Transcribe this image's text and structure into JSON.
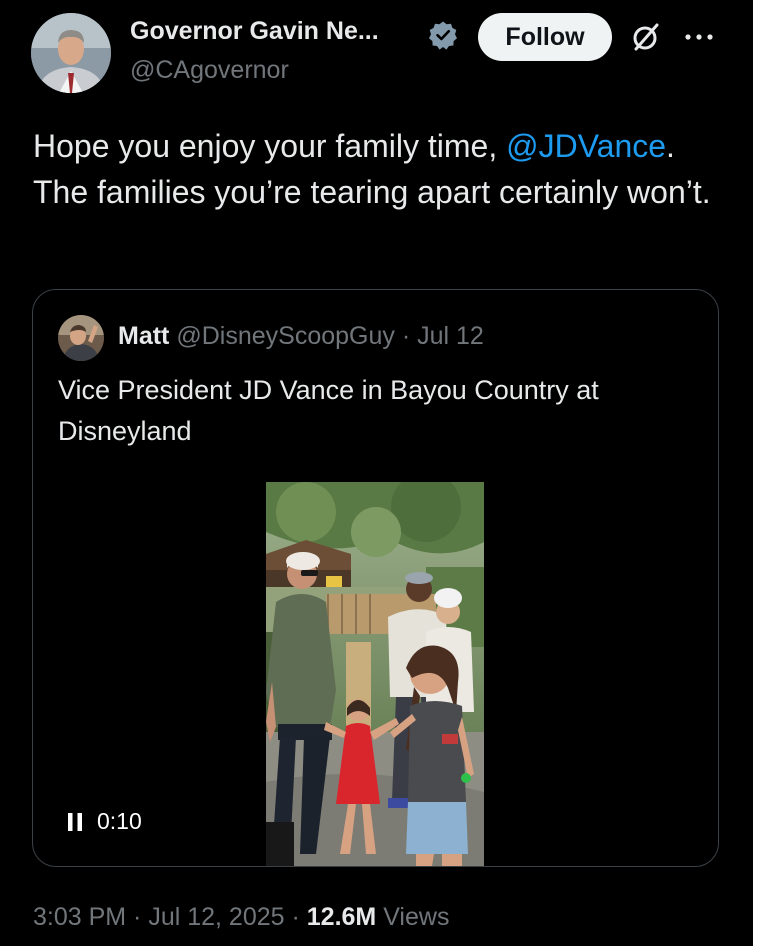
{
  "author": {
    "display_name": "Governor Gavin Ne...",
    "handle": "@CAgovernor",
    "verified_icon": "verified-badge-icon"
  },
  "actions": {
    "follow_label": "Follow",
    "grok_icon": "grok-icon",
    "more_icon": "more-icon"
  },
  "tweet": {
    "text_before": "Hope you enjoy your family time, ",
    "mention": "@JDVance",
    "text_after": ". The families you’re tearing apart certainly won’t."
  },
  "quote": {
    "name": "Matt",
    "handle": "@DisneyScoopGuy",
    "separator": " · ",
    "date": "Jul 12",
    "text": "Vice President JD Vance in Bayou Country at Disneyland",
    "video": {
      "elapsed": "0:10",
      "control_icon": "pause-icon"
    }
  },
  "footer": {
    "time": "3:03 PM",
    "separator": " · ",
    "date": "Jul 12, 2025",
    "views_count": "12.6M",
    "views_label": "Views"
  },
  "colors": {
    "background": "#000000",
    "text": "#e7e9ea",
    "secondary_text": "#71767b",
    "link": "#1d9bf0",
    "verified": "#829aab",
    "follow_bg": "#eff3f4",
    "card_border": "#3b4045"
  }
}
